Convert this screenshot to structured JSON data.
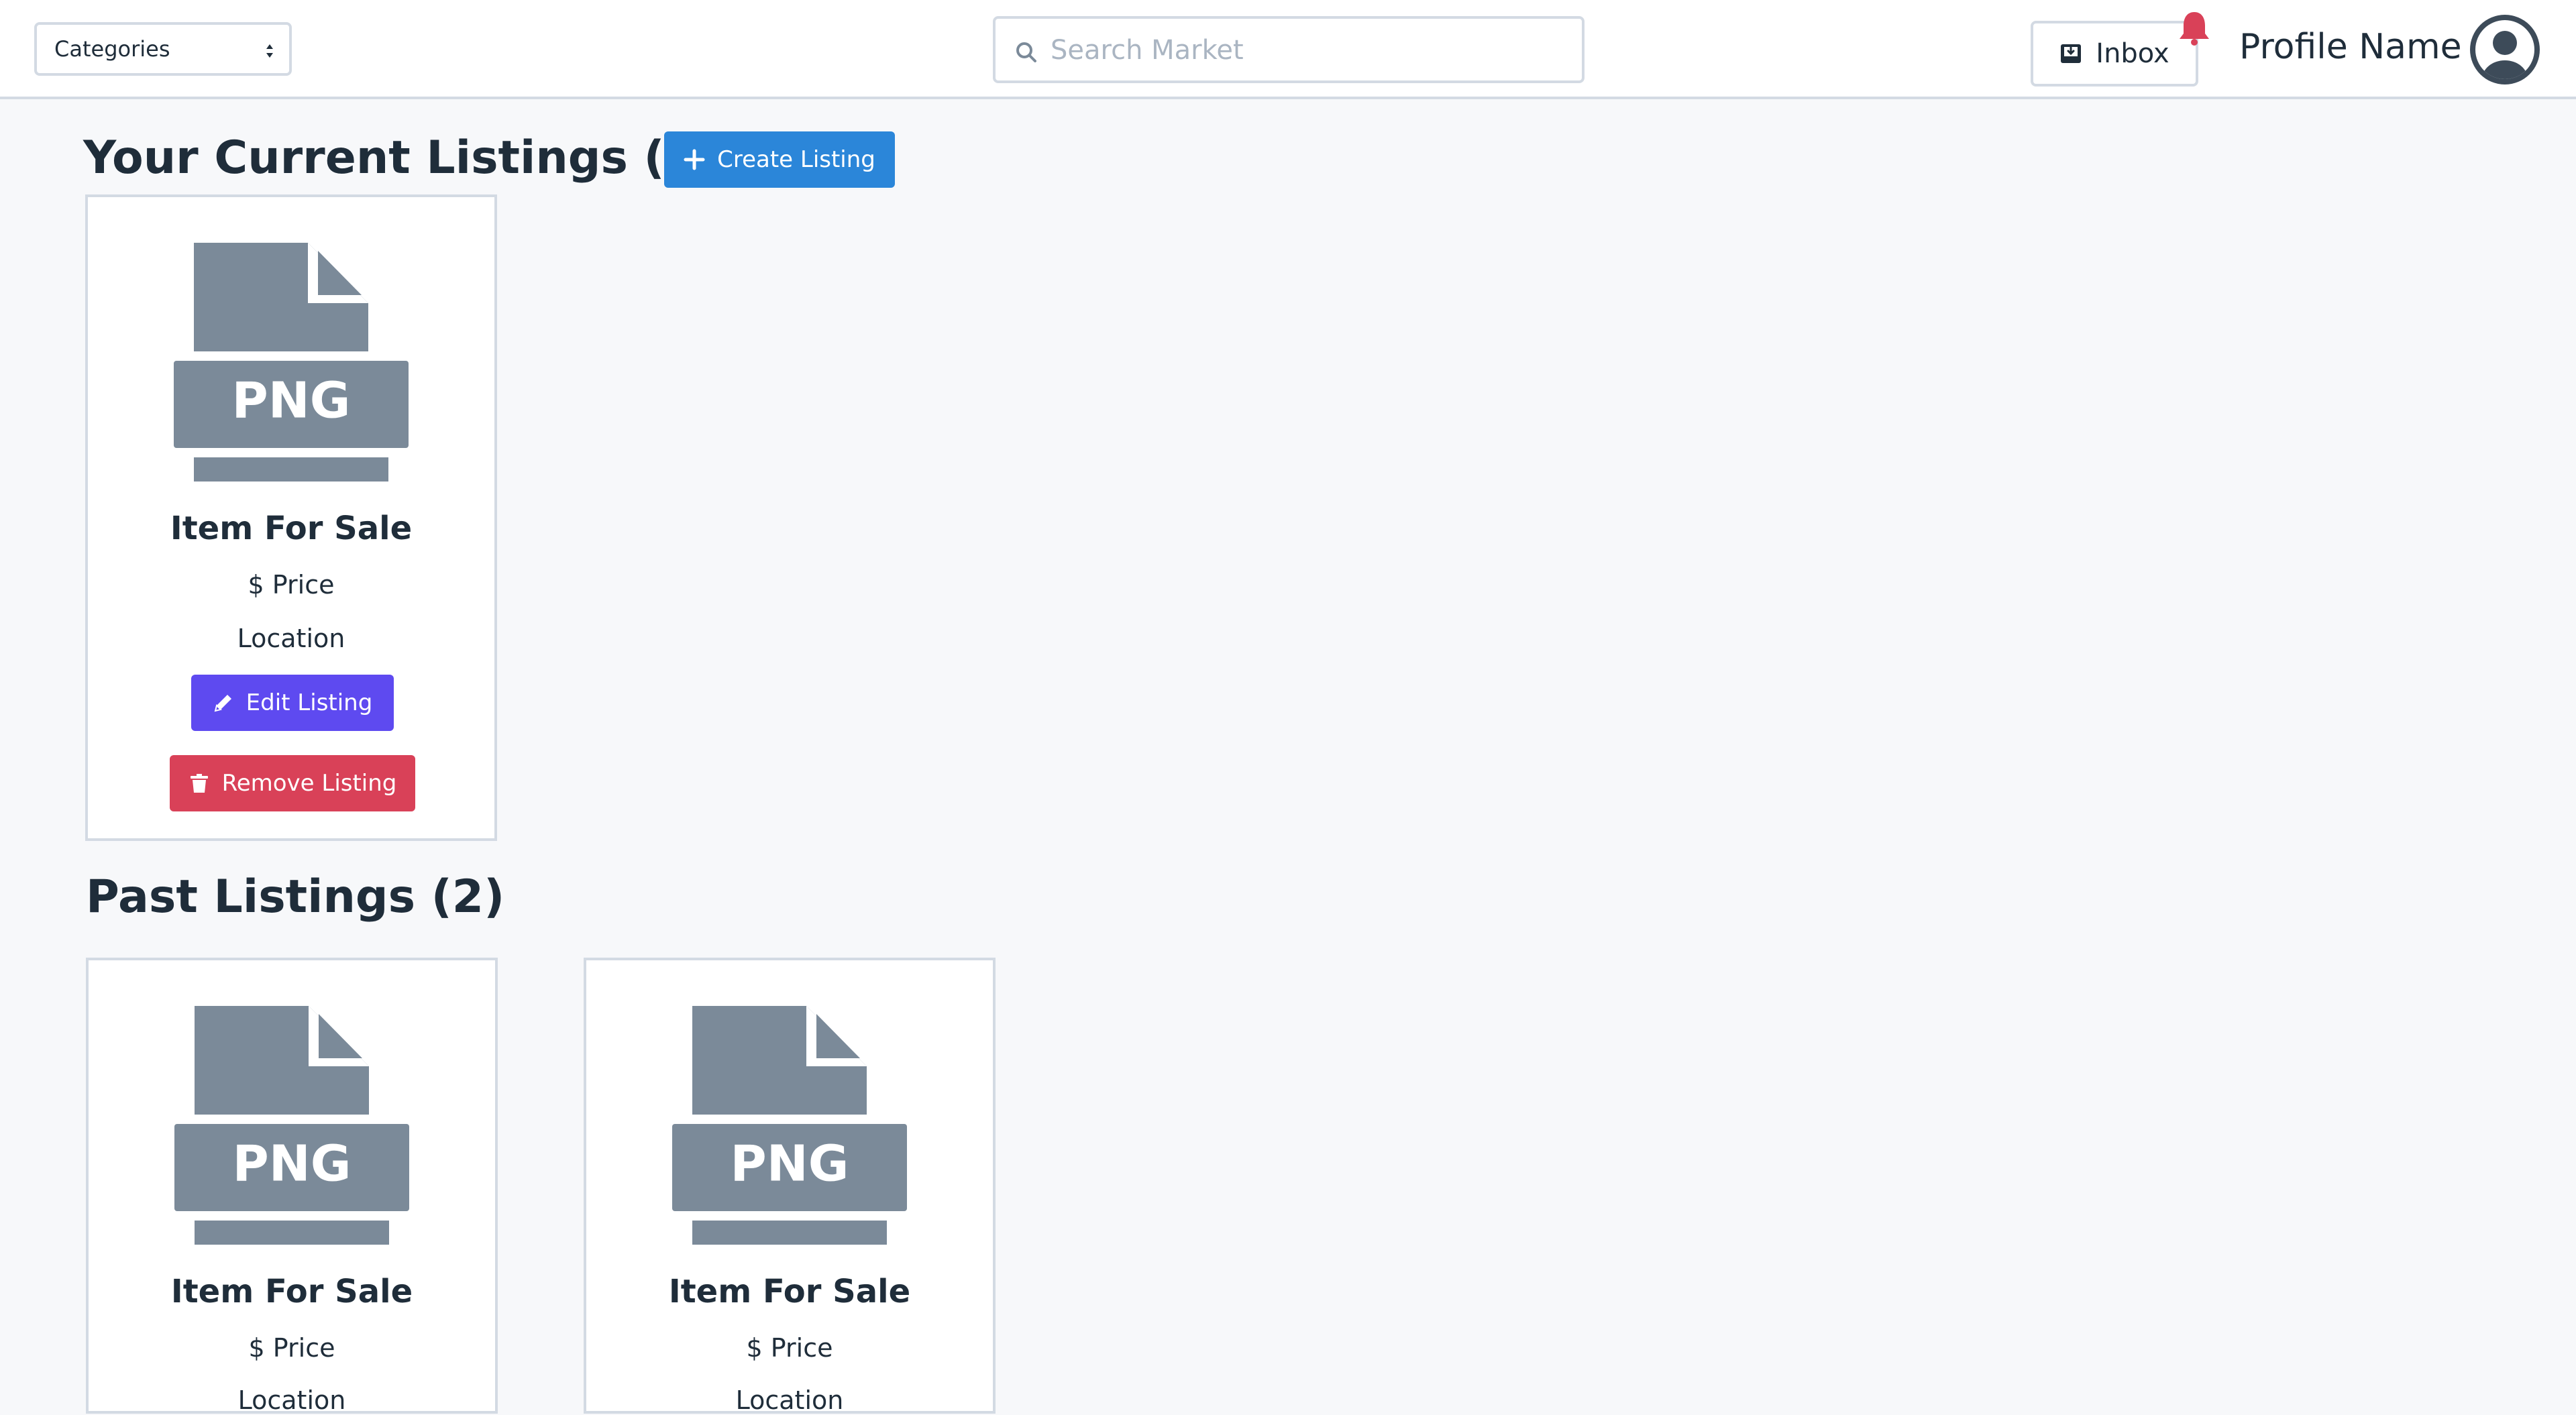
{
  "header": {
    "categories_label": "Categories",
    "search_placeholder": "Search Market",
    "search_value": "",
    "inbox_label": "Inbox",
    "profile_name": "Profile Name"
  },
  "current": {
    "title": "Your Current Listings (1)",
    "create_label": "Create Listing",
    "items": [
      {
        "thumb_text": "PNG",
        "title": "Item For Sale",
        "price": "$ Price",
        "location": "Location",
        "edit_label": "Edit Listing",
        "remove_label": "Remove Listing"
      }
    ]
  },
  "past": {
    "title": "Past Listings (2)",
    "items": [
      {
        "thumb_text": "PNG",
        "title": "Item For Sale",
        "price": "$ Price",
        "location": "Location"
      },
      {
        "thumb_text": "PNG",
        "title": "Item For Sale",
        "price": "$ Price",
        "location": "Location"
      }
    ]
  },
  "colors": {
    "primary": "#2b86d9",
    "edit": "#5e4af0",
    "danger": "#d94158",
    "icon_gray": "#7b8a99"
  }
}
